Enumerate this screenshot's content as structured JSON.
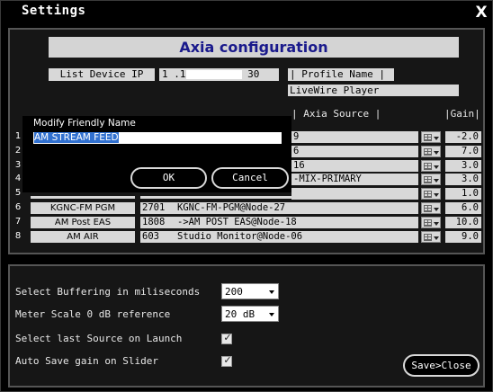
{
  "window": {
    "title": "Settings",
    "close_label": "X"
  },
  "heading": "Axia configuration",
  "device_ip": {
    "label": "List Device IP",
    "prefix": "1",
    "middle": ".1",
    "suffix": "30"
  },
  "profile": {
    "label": "| Profile Name |",
    "value": "LiveWire Player"
  },
  "columns": {
    "source": "| Axia Source |",
    "gain": "|Gain|"
  },
  "rows": [
    {
      "num": "1",
      "name": "",
      "source": "9",
      "gain": "-2.0"
    },
    {
      "num": "2",
      "name": "",
      "source": "6",
      "gain": "7.0"
    },
    {
      "num": "3",
      "name": "",
      "source": "16",
      "gain": "3.0"
    },
    {
      "num": "4",
      "name": "",
      "source": "-MIX-PRIMARY",
      "gain": "3.0"
    },
    {
      "num": "5",
      "name": "",
      "source": "",
      "gain": "1.0"
    },
    {
      "num": "6",
      "name": "KGNC-FM PGM",
      "channel": "2701",
      "source": "KGNC-FM-PGM@Node-27",
      "gain": "6.0"
    },
    {
      "num": "7",
      "name": "AM Post EAS",
      "channel": "1808",
      "source": "->AM POST EAS@Node-18",
      "gain": "10.0"
    },
    {
      "num": "8",
      "name": "AM AIR",
      "channel": "603",
      "source": "Studio Monitor@Node-06",
      "gain": "9.0"
    }
  ],
  "dialog": {
    "label": "Modify Friendly Name",
    "value": "AM STREAM FEED",
    "ok_label": "OK",
    "cancel_label": "Cancel"
  },
  "settings": {
    "buffering": {
      "label": "Select Buffering in miliseconds",
      "value": "200"
    },
    "meter": {
      "label": "Meter Scale 0 dB reference",
      "value": "20 dB"
    },
    "last_source": {
      "label": "Select last Source on Launch",
      "checked": true,
      "mark": "✓"
    },
    "auto_save": {
      "label": "Auto Save gain on Slider",
      "checked": true,
      "mark": "✓"
    }
  },
  "save_close_label": "Save>Close",
  "colors": {
    "heading_text": "#1a1a8c",
    "selection": "#3070d0",
    "panel_bg": "#161616"
  }
}
